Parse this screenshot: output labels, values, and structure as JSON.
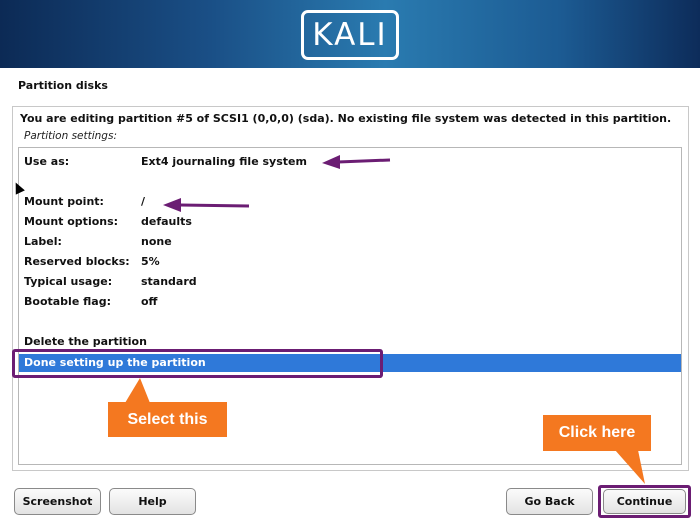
{
  "header": {
    "logo_text": "KALI"
  },
  "page": {
    "title": "Partition disks"
  },
  "content": {
    "description": "You are editing partition #5 of SCSI1 (0,0,0) (sda). No existing file system was detected in this partition.",
    "subheading": "Partition settings:",
    "settings": [
      {
        "label": "Use as:",
        "value": "Ext4 journaling file system"
      },
      {
        "label": "Mount point:",
        "value": "/"
      },
      {
        "label": "Mount options:",
        "value": "defaults"
      },
      {
        "label": "Label:",
        "value": "none"
      },
      {
        "label": "Reserved blocks:",
        "value": "5%"
      },
      {
        "label": "Typical usage:",
        "value": "standard"
      },
      {
        "label": "Bootable flag:",
        "value": "off"
      }
    ],
    "actions": [
      {
        "label": "Delete the partition"
      },
      {
        "label": "Done setting up the partition",
        "selected": true
      }
    ]
  },
  "annotations": {
    "select_note": "Select this",
    "click_note": "Click here",
    "accent_color": "#6b1d73",
    "note_color": "#f47820"
  },
  "buttons": {
    "screenshot": "Screenshot",
    "help": "Help",
    "go_back": "Go Back",
    "continue": "Continue"
  },
  "colors": {
    "selection": "#2f79d9"
  }
}
